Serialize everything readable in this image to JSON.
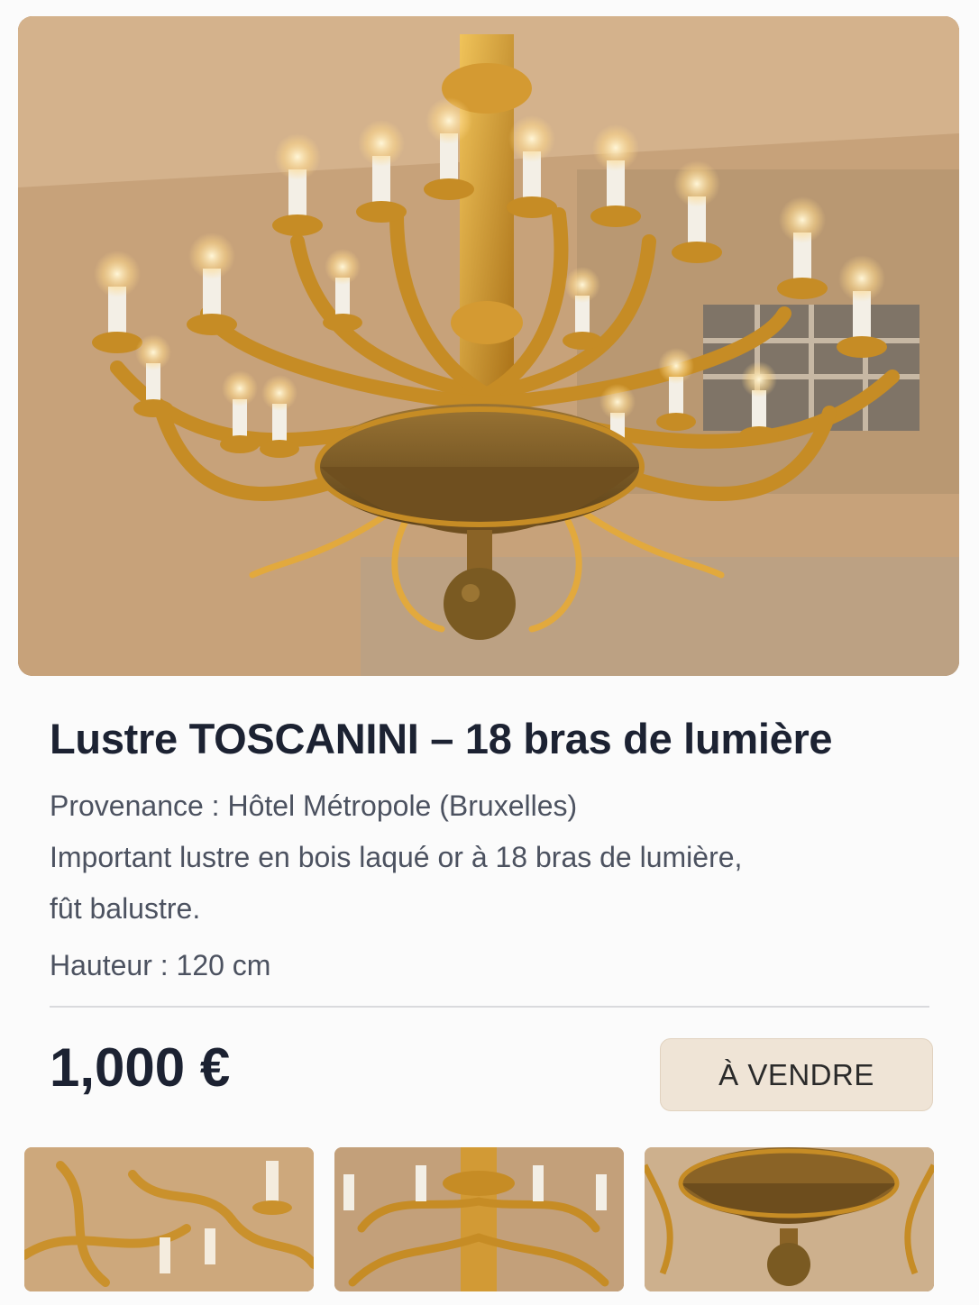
{
  "product": {
    "title": "Lustre TOSCANINI – 18 bras de lumière",
    "provenance": "Provenance : Hôtel Métropole (Bruxelles)",
    "description_line1": "Important lustre en bois laqué or à 18 bras de lumière,",
    "description_line2": "fût balustre.",
    "height": "Hauteur : 120 cm",
    "price": "1,000 €",
    "status": "À VENDRE"
  },
  "images": {
    "main": "chandelier-photo",
    "thumbnails": [
      "chandelier-arms-detail",
      "chandelier-center-detail",
      "chandelier-bowl-detail"
    ]
  },
  "colors": {
    "gold": "#c9962f",
    "badge_bg": "#efe4d6",
    "title": "#1c2232"
  }
}
